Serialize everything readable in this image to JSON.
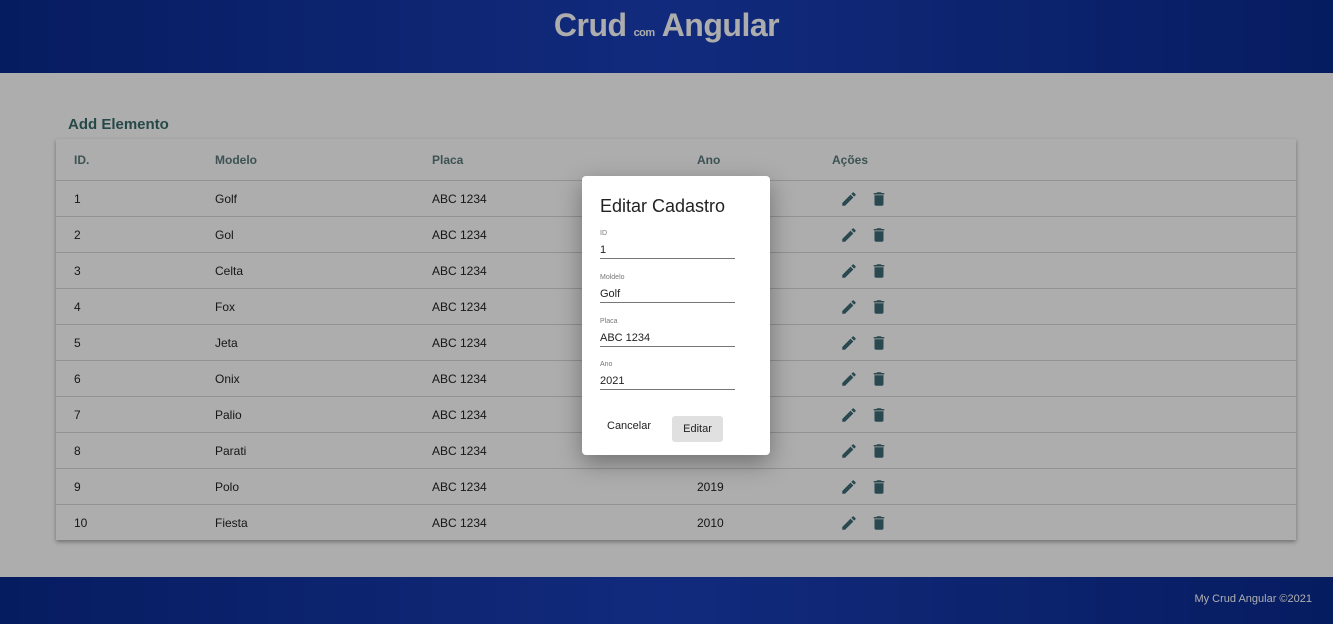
{
  "header": {
    "brand_left": "Crud",
    "brand_small": "com",
    "brand_right": "Angular"
  },
  "add_link": "Add Elemento",
  "table": {
    "columns": [
      "ID.",
      "Modelo",
      "Placa",
      "Ano",
      "Ações"
    ],
    "rows": [
      {
        "id": "1",
        "modelo": "Golf",
        "placa": "ABC 1234",
        "ano": ""
      },
      {
        "id": "2",
        "modelo": "Gol",
        "placa": "ABC 1234",
        "ano": ""
      },
      {
        "id": "3",
        "modelo": "Celta",
        "placa": "ABC 1234",
        "ano": ""
      },
      {
        "id": "4",
        "modelo": "Fox",
        "placa": "ABC 1234",
        "ano": ""
      },
      {
        "id": "5",
        "modelo": "Jeta",
        "placa": "ABC 1234",
        "ano": ""
      },
      {
        "id": "6",
        "modelo": "Onix",
        "placa": "ABC 1234",
        "ano": ""
      },
      {
        "id": "7",
        "modelo": "Palio",
        "placa": "ABC 1234",
        "ano": ""
      },
      {
        "id": "8",
        "modelo": "Parati",
        "placa": "ABC 1234",
        "ano": ""
      },
      {
        "id": "9",
        "modelo": "Polo",
        "placa": "ABC 1234",
        "ano": "2019"
      },
      {
        "id": "10",
        "modelo": "Fiesta",
        "placa": "ABC 1234",
        "ano": "2010"
      }
    ],
    "action_icons": [
      "edit-icon",
      "delete-icon"
    ]
  },
  "dialog": {
    "title": "Editar Cadastro",
    "fields": [
      {
        "label": "ID",
        "value": "1"
      },
      {
        "label": "Moldelo",
        "value": "Golf"
      },
      {
        "label": "Placa",
        "value": "ABC 1234"
      },
      {
        "label": "Ano",
        "value": "2021"
      }
    ],
    "cancel_label": "Cancelar",
    "submit_label": "Editar"
  },
  "footer": {
    "text": "My Crud Angular ©2021"
  },
  "colors": {
    "header_bg": "#0a2a8f",
    "accent": "#3f6b75",
    "overlay": "rgba(0,0,0,0.32)"
  }
}
